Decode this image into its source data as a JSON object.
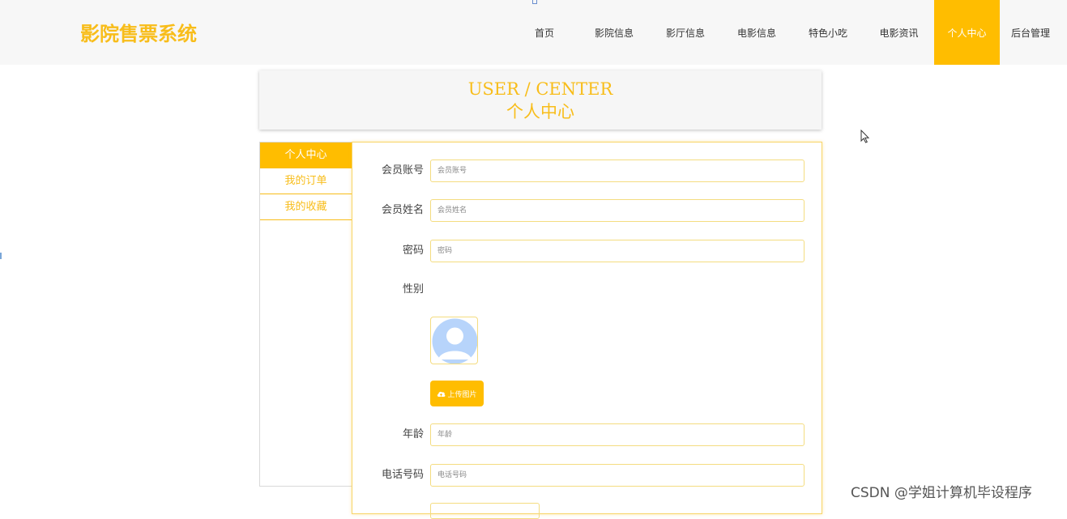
{
  "app": {
    "logo": "影院售票系统"
  },
  "nav": {
    "items": [
      {
        "label": "首页"
      },
      {
        "label": "影院信息"
      },
      {
        "label": "影厅信息"
      },
      {
        "label": "电影信息"
      },
      {
        "label": "特色小吃"
      },
      {
        "label": "电影资讯"
      },
      {
        "label": "个人中心",
        "active": true
      },
      {
        "label": "后台管理"
      }
    ]
  },
  "header": {
    "title_en": "USER / CENTER",
    "title_cn": "个人中心"
  },
  "sidebar": {
    "items": [
      {
        "label": "个人中心",
        "active": true
      },
      {
        "label": "我的订单"
      },
      {
        "label": "我的收藏"
      }
    ]
  },
  "form": {
    "account": {
      "label": "会员账号",
      "placeholder": "会员账号",
      "value": ""
    },
    "name": {
      "label": "会员姓名",
      "placeholder": "会员姓名",
      "value": ""
    },
    "password": {
      "label": "密码",
      "placeholder": "密码",
      "value": ""
    },
    "gender": {
      "label": "性别"
    },
    "upload_label": "上传图片",
    "age": {
      "label": "年龄",
      "placeholder": "年龄",
      "value": ""
    },
    "phone": {
      "label": "电话号码",
      "placeholder": "电话号码",
      "value": ""
    }
  },
  "watermark": "CSDN @学姐计算机毕设程序",
  "colors": {
    "accent": "#ffbd00",
    "logo": "#f8bd1a",
    "border": "#f4dc80",
    "avatar": "#b7d4fb"
  },
  "icons": {
    "avatar": "user-avatar-icon",
    "upload": "cloud-upload-icon",
    "cursor": "mouse-cursor-icon"
  }
}
